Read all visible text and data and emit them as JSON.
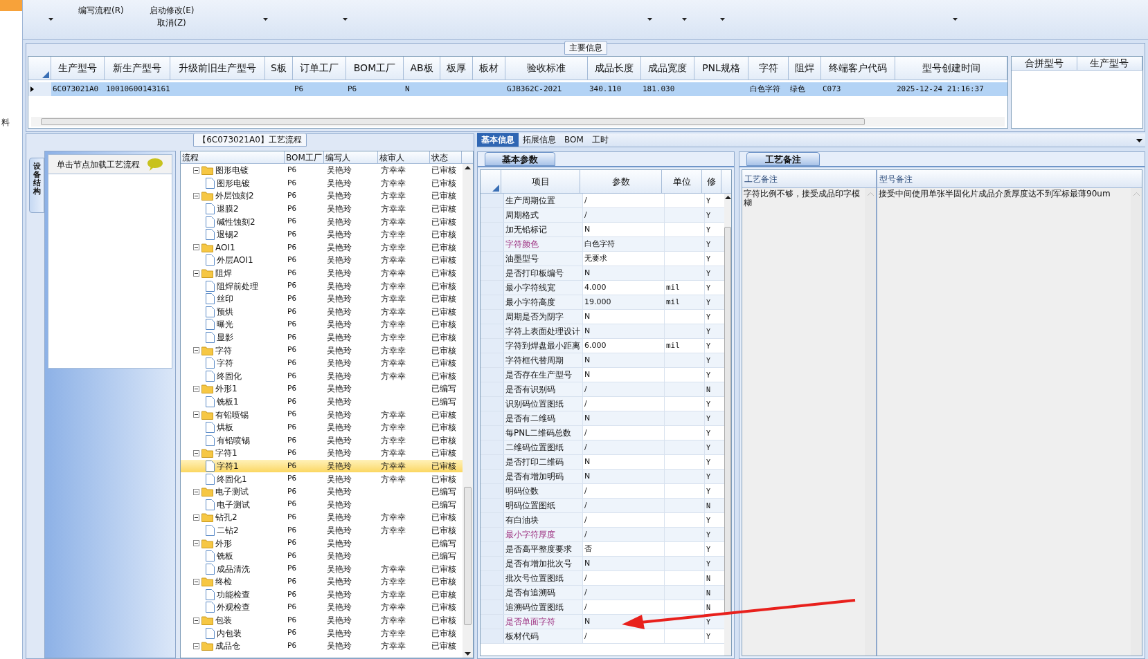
{
  "strip": {
    "label": "料"
  },
  "toolbar": {
    "buttons": [
      {
        "label": "编写流程(R)"
      },
      {
        "label": "启动修改(E)"
      },
      {
        "label": "取消(Z)"
      }
    ]
  },
  "main_info": {
    "title": "主要信息",
    "columns": [
      "生产型号",
      "新生产型号",
      "升级前旧生产型号",
      "S板",
      "订单工厂",
      "BOM工厂",
      "AB板",
      "板厚",
      "板材",
      "验收标准",
      "成品长度",
      "成品宽度",
      "PNL规格",
      "字符",
      "阻焊",
      "终端客户代码",
      "型号创建时间"
    ],
    "rows": [
      {
        "selected": true,
        "cells": [
          "6C073021A0",
          "10010600143161",
          null,
          null,
          "P6",
          "P6",
          "N",
          null,
          null,
          "GJB362C-2021",
          "340.110",
          "181.030",
          null,
          "白色字符",
          "绿色",
          "C073",
          "2025-12-24 21:16:37"
        ]
      }
    ],
    "merge_columns": [
      "合拼型号",
      "生产型号"
    ]
  },
  "process": {
    "title": "【6C073021A0】工艺流程",
    "side_tab": "设备结构",
    "list_header": "单击节点加载工艺流程",
    "columns": [
      "流程",
      "BOM工厂",
      "编写人",
      "核审人",
      "状态"
    ],
    "tree": [
      {
        "name": "图形电镀",
        "bom": "P6",
        "writer": "吴艳玲",
        "reviewer": "方幸幸",
        "status": "已审核",
        "expanded": true,
        "selected": false,
        "children": [
          {
            "name": "图形电镀",
            "bom": "P6",
            "writer": "吴艳玲",
            "reviewer": "方幸幸",
            "status": "已审核",
            "selected": false
          }
        ]
      },
      {
        "name": "外层蚀刻2",
        "bom": "P6",
        "writer": "吴艳玲",
        "reviewer": "方幸幸",
        "status": "已审核",
        "expanded": true,
        "selected": false,
        "children": [
          {
            "name": "退膜2",
            "bom": "P6",
            "writer": "吴艳玲",
            "reviewer": "方幸幸",
            "status": "已审核",
            "selected": false
          },
          {
            "name": "碱性蚀刻2",
            "bom": "P6",
            "writer": "吴艳玲",
            "reviewer": "方幸幸",
            "status": "已审核",
            "selected": false
          },
          {
            "name": "退锡2",
            "bom": "P6",
            "writer": "吴艳玲",
            "reviewer": "方幸幸",
            "status": "已审核",
            "selected": false
          }
        ]
      },
      {
        "name": "AOI1",
        "bom": "P6",
        "writer": "吴艳玲",
        "reviewer": "方幸幸",
        "status": "已审核",
        "expanded": true,
        "selected": false,
        "children": [
          {
            "name": "外层AOI1",
            "bom": "P6",
            "writer": "吴艳玲",
            "reviewer": "方幸幸",
            "status": "已审核",
            "selected": false
          }
        ]
      },
      {
        "name": "阻焊",
        "bom": "P6",
        "writer": "吴艳玲",
        "reviewer": "方幸幸",
        "status": "已审核",
        "expanded": true,
        "selected": false,
        "children": [
          {
            "name": "阻焊前处理",
            "bom": "P6",
            "writer": "吴艳玲",
            "reviewer": "方幸幸",
            "status": "已审核",
            "selected": false
          },
          {
            "name": "丝印",
            "bom": "P6",
            "writer": "吴艳玲",
            "reviewer": "方幸幸",
            "status": "已审核",
            "selected": false
          },
          {
            "name": "预烘",
            "bom": "P6",
            "writer": "吴艳玲",
            "reviewer": "方幸幸",
            "status": "已审核",
            "selected": false
          },
          {
            "name": "曝光",
            "bom": "P6",
            "writer": "吴艳玲",
            "reviewer": "方幸幸",
            "status": "已审核",
            "selected": false
          },
          {
            "name": "显影",
            "bom": "P6",
            "writer": "吴艳玲",
            "reviewer": "方幸幸",
            "status": "已审核",
            "selected": false
          }
        ]
      },
      {
        "name": "字符",
        "bom": "P6",
        "writer": "吴艳玲",
        "reviewer": "方幸幸",
        "status": "已审核",
        "expanded": true,
        "selected": false,
        "children": [
          {
            "name": "字符",
            "bom": "P6",
            "writer": "吴艳玲",
            "reviewer": "方幸幸",
            "status": "已审核",
            "selected": false
          },
          {
            "name": "终固化",
            "bom": "P6",
            "writer": "吴艳玲",
            "reviewer": "方幸幸",
            "status": "已审核",
            "selected": false
          }
        ]
      },
      {
        "name": "外形1",
        "bom": "P6",
        "writer": "吴艳玲",
        "status": "已编写",
        "expanded": true,
        "selected": false,
        "children": [
          {
            "name": "铣板1",
            "bom": "P6",
            "writer": "吴艳玲",
            "status": "已编写",
            "selected": false
          }
        ]
      },
      {
        "name": "有铅喷锡",
        "bom": "P6",
        "writer": "吴艳玲",
        "reviewer": "方幸幸",
        "status": "已审核",
        "expanded": true,
        "selected": false,
        "children": [
          {
            "name": "烘板",
            "bom": "P6",
            "writer": "吴艳玲",
            "reviewer": "方幸幸",
            "status": "已审核",
            "selected": false
          },
          {
            "name": "有铅喷锡",
            "bom": "P6",
            "writer": "吴艳玲",
            "reviewer": "方幸幸",
            "status": "已审核",
            "selected": false
          }
        ]
      },
      {
        "name": "字符1",
        "bom": "P6",
        "writer": "吴艳玲",
        "reviewer": "方幸幸",
        "status": "已审核",
        "expanded": true,
        "selected": false,
        "children": [
          {
            "name": "字符1",
            "bom": "P6",
            "writer": "吴艳玲",
            "reviewer": "方幸幸",
            "status": "已审核",
            "selected": true
          },
          {
            "name": "终固化1",
            "bom": "P6",
            "writer": "吴艳玲",
            "reviewer": "方幸幸",
            "status": "已审核",
            "selected": false
          }
        ]
      },
      {
        "name": "电子测试",
        "bom": "P6",
        "writer": "吴艳玲",
        "status": "已编写",
        "expanded": true,
        "selected": false,
        "children": [
          {
            "name": "电子测试",
            "bom": "P6",
            "writer": "吴艳玲",
            "status": "已编写",
            "selected": false
          }
        ]
      },
      {
        "name": "钻孔2",
        "bom": "P6",
        "writer": "吴艳玲",
        "reviewer": "方幸幸",
        "status": "已审核",
        "expanded": true,
        "selected": false,
        "children": [
          {
            "name": "二钻2",
            "bom": "P6",
            "writer": "吴艳玲",
            "reviewer": "方幸幸",
            "status": "已审核",
            "selected": false
          }
        ]
      },
      {
        "name": "外形",
        "bom": "P6",
        "writer": "吴艳玲",
        "status": "已编写",
        "expanded": true,
        "selected": false,
        "children": [
          {
            "name": "铣板",
            "bom": "P6",
            "writer": "吴艳玲",
            "status": "已编写",
            "selected": false
          },
          {
            "name": "成品清洗",
            "bom": "P6",
            "writer": "吴艳玲",
            "reviewer": "方幸幸",
            "status": "已审核",
            "selected": false
          }
        ]
      },
      {
        "name": "终检",
        "bom": "P6",
        "writer": "吴艳玲",
        "reviewer": "方幸幸",
        "status": "已审核",
        "expanded": true,
        "selected": false,
        "children": [
          {
            "name": "功能检查",
            "bom": "P6",
            "writer": "吴艳玲",
            "reviewer": "方幸幸",
            "status": "已审核",
            "selected": false
          },
          {
            "name": "外观检查",
            "bom": "P6",
            "writer": "吴艳玲",
            "reviewer": "方幸幸",
            "status": "已审核",
            "selected": false
          }
        ]
      },
      {
        "name": "包装",
        "bom": "P6",
        "writer": "吴艳玲",
        "reviewer": "方幸幸",
        "status": "已审核",
        "expanded": true,
        "selected": false,
        "children": [
          {
            "name": "内包装",
            "bom": "P6",
            "writer": "吴艳玲",
            "reviewer": "方幸幸",
            "status": "已审核",
            "selected": false
          }
        ]
      },
      {
        "name": "成品仓",
        "bom": "P6",
        "writer": "吴艳玲",
        "reviewer": "方幸幸",
        "status": "已审核",
        "expanded": true,
        "selected": false
      }
    ]
  },
  "detail_tabs": [
    {
      "label": "基本信息",
      "selected": true
    },
    {
      "label": "拓展信息",
      "selected": false
    },
    {
      "label": "BOM",
      "selected": false
    },
    {
      "label": "工时",
      "selected": false
    }
  ],
  "params": {
    "tab": "基本参数",
    "columns": [
      "项目",
      "参数",
      "单位",
      "修"
    ],
    "rows": [
      {
        "item": "生产周期位置",
        "value": "/",
        "flag": "Y",
        "highlighted": false
      },
      {
        "item": "周期格式",
        "value": "/",
        "flag": "Y",
        "highlighted": false
      },
      {
        "item": "加无铅标记",
        "value": "N",
        "flag": "Y",
        "highlighted": false
      },
      {
        "item": "字符颜色",
        "value": "白色字符",
        "flag": "Y",
        "highlighted": true
      },
      {
        "item": "油墨型号",
        "value": "无要求",
        "flag": "Y",
        "highlighted": false
      },
      {
        "item": "是否打印板编号",
        "value": "N",
        "flag": "Y",
        "highlighted": false
      },
      {
        "item": "最小字符线宽",
        "value": "4.000",
        "unit": "mil",
        "flag": "Y",
        "highlighted": false
      },
      {
        "item": "最小字符高度",
        "value": "19.000",
        "unit": "mil",
        "flag": "Y",
        "highlighted": false
      },
      {
        "item": "周期是否为阴字",
        "value": "N",
        "flag": "Y",
        "highlighted": false
      },
      {
        "item": "字符上表面处理设计",
        "value": "N",
        "flag": "Y",
        "highlighted": false
      },
      {
        "item": "字符到焊盘最小距离",
        "value": "6.000",
        "unit": "mil",
        "flag": "Y",
        "highlighted": false
      },
      {
        "item": "字符框代替周期",
        "value": "N",
        "flag": "Y",
        "highlighted": false
      },
      {
        "item": "是否存在生产型号",
        "value": "N",
        "flag": "Y",
        "highlighted": false
      },
      {
        "item": "是否有识别码",
        "value": "/",
        "flag": "N",
        "highlighted": false
      },
      {
        "item": "识别码位置图纸",
        "value": "/",
        "flag": "Y",
        "highlighted": false
      },
      {
        "item": "是否有二维码",
        "value": "N",
        "flag": "Y",
        "highlighted": false
      },
      {
        "item": "每PNL二维码总数",
        "value": "/",
        "flag": "Y",
        "highlighted": false
      },
      {
        "item": "二维码位置图纸",
        "value": "/",
        "flag": "Y",
        "highlighted": false
      },
      {
        "item": "是否打印二维码",
        "value": "N",
        "flag": "Y",
        "highlighted": false
      },
      {
        "item": "是否有增加明码",
        "value": "N",
        "flag": "Y",
        "highlighted": false
      },
      {
        "item": "明码位数",
        "value": "/",
        "flag": "Y",
        "highlighted": false
      },
      {
        "item": "明码位置图纸",
        "value": "/",
        "flag": "N",
        "highlighted": false
      },
      {
        "item": "有白油块",
        "value": "/",
        "flag": "Y",
        "highlighted": false
      },
      {
        "item": "最小字符厚度",
        "value": "/",
        "flag": "Y",
        "highlighted": true
      },
      {
        "item": "是否高平整度要求",
        "value": "否",
        "flag": "Y",
        "highlighted": false
      },
      {
        "item": "是否有增加批次号",
        "value": "N",
        "flag": "Y",
        "highlighted": false
      },
      {
        "item": "批次号位置图纸",
        "value": "/",
        "flag": "N",
        "highlighted": false
      },
      {
        "item": "是否有追溯码",
        "value": "/",
        "flag": "N",
        "highlighted": false
      },
      {
        "item": "追溯码位置图纸",
        "value": "/",
        "flag": "N",
        "highlighted": false
      },
      {
        "item": "是否单面字符",
        "value": "N",
        "flag": "Y",
        "highlighted": true
      },
      {
        "item": "板材代码",
        "value": "/",
        "flag": "Y",
        "highlighted": false
      }
    ]
  },
  "notes": {
    "tab": "工艺备注",
    "columns": [
      "工艺备注",
      "型号备注"
    ],
    "values": [
      "字符比例不够，接受成品印字模糊",
      "接受中间使用单张半固化片成品介质厚度达不到军标最薄90um"
    ]
  }
}
